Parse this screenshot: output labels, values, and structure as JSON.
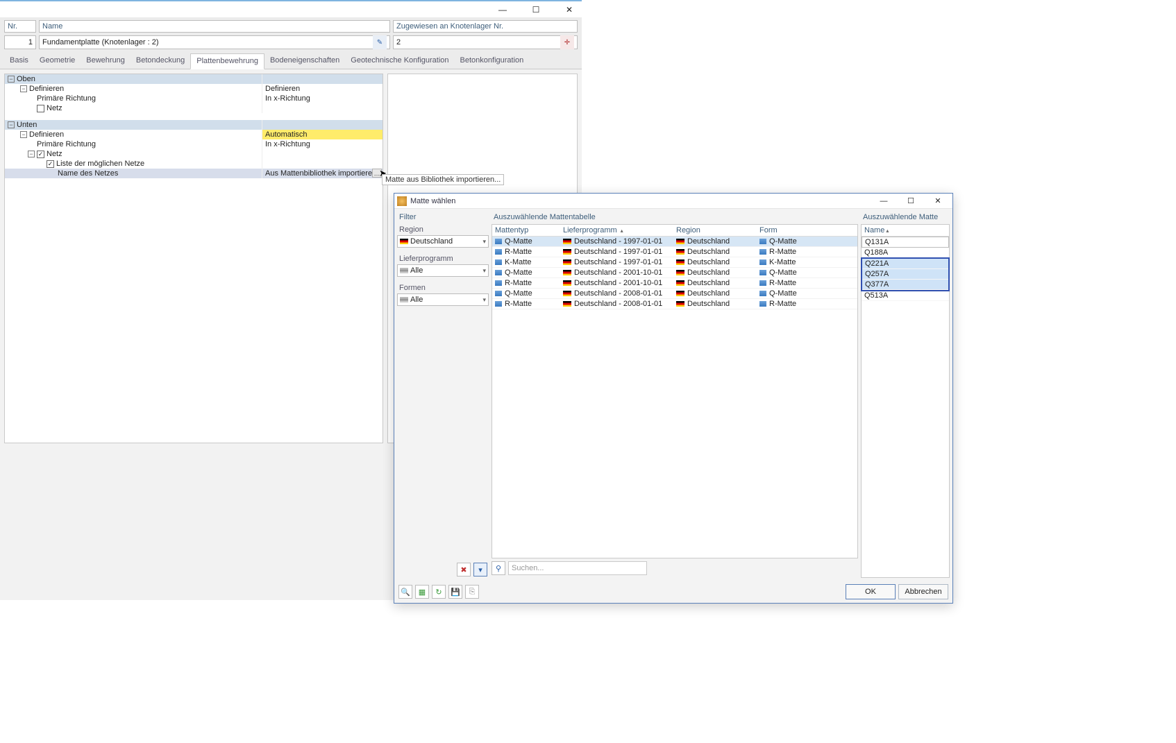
{
  "main": {
    "header": {
      "nr_label": "Nr.",
      "name_label": "Name",
      "assign_label": "Zugewiesen an Knotenlager Nr."
    },
    "values": {
      "nr": "1",
      "name": "Fundamentplatte (Knotenlager : 2)",
      "assign": "2"
    },
    "tabs": [
      "Basis",
      "Geometrie",
      "Bewehrung",
      "Betondeckung",
      "Plattenbewehrung",
      "Bodeneigenschaften",
      "Geotechnische Konfiguration",
      "Betonkonfiguration"
    ],
    "active_tab": 4,
    "tree": {
      "oben": "Oben",
      "unten": "Unten",
      "definieren": "Definieren",
      "primaer": "Primäre Richtung",
      "netz": "Netz",
      "liste": "Liste der möglichen Netze",
      "name_netz": "Name des Netzes",
      "val_definieren_oben": "Definieren",
      "val_in_x": "In x-Richtung",
      "val_auto": "Automatisch",
      "val_import": "Aus Mattenbibliothek importieren"
    },
    "tooltip": "Matte aus Bibliothek importieren..."
  },
  "dialog": {
    "title": "Matte wählen",
    "filter": {
      "header": "Filter",
      "region_label": "Region",
      "region_value": "Deutschland",
      "liefer_label": "Lieferprogramm",
      "liefer_value": "Alle",
      "formen_label": "Formen",
      "formen_value": "Alle"
    },
    "table": {
      "header": "Auszuwählende Mattentabelle",
      "cols": {
        "typ": "Mattentyp",
        "liefer": "Lieferprogramm",
        "region": "Region",
        "form": "Form"
      },
      "rows": [
        {
          "typ": "Q-Matte",
          "liefer": "Deutschland - 1997-01-01",
          "region": "Deutschland",
          "form": "Q-Matte",
          "sel": true
        },
        {
          "typ": "R-Matte",
          "liefer": "Deutschland - 1997-01-01",
          "region": "Deutschland",
          "form": "R-Matte"
        },
        {
          "typ": "K-Matte",
          "liefer": "Deutschland - 1997-01-01",
          "region": "Deutschland",
          "form": "K-Matte"
        },
        {
          "typ": "Q-Matte",
          "liefer": "Deutschland - 2001-10-01",
          "region": "Deutschland",
          "form": "Q-Matte"
        },
        {
          "typ": "R-Matte",
          "liefer": "Deutschland - 2001-10-01",
          "region": "Deutschland",
          "form": "R-Matte"
        },
        {
          "typ": "Q-Matte",
          "liefer": "Deutschland - 2008-01-01",
          "region": "Deutschland",
          "form": "Q-Matte"
        },
        {
          "typ": "R-Matte",
          "liefer": "Deutschland - 2008-01-01",
          "region": "Deutschland",
          "form": "R-Matte"
        }
      ]
    },
    "names": {
      "header": "Auszuwählende Matte",
      "col": "Name",
      "items": [
        {
          "n": "Q131A",
          "first": true
        },
        {
          "n": "Q188A"
        },
        {
          "n": "Q221A",
          "sel": true,
          "box_start": true
        },
        {
          "n": "Q257A",
          "sel": true
        },
        {
          "n": "Q377A",
          "sel": true,
          "box_end": true
        },
        {
          "n": "Q513A"
        }
      ]
    },
    "search_placeholder": "Suchen...",
    "ok": "OK",
    "cancel": "Abbrechen"
  }
}
